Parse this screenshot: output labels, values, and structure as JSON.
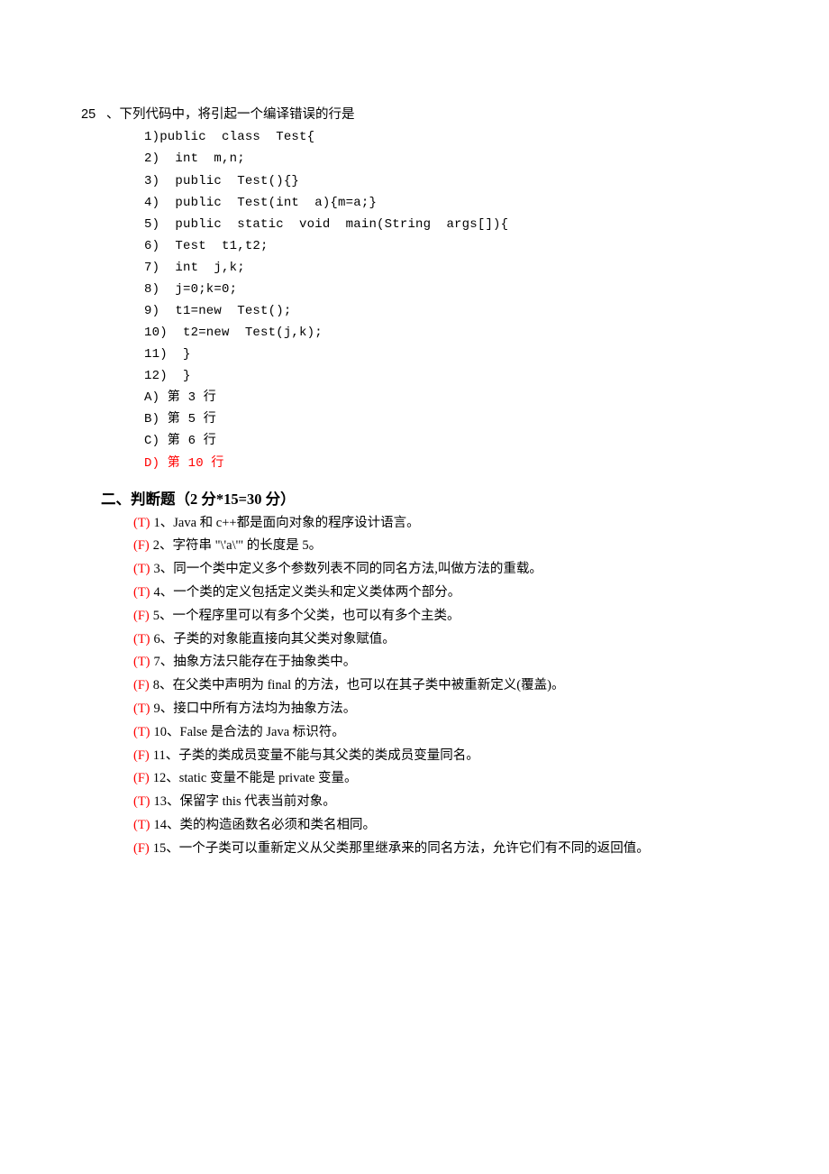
{
  "question25": {
    "number": "25",
    "stem_sep": "、",
    "stem_text": "下列代码中，将引起一个编译错误的行是",
    "code": [
      "1)public  class  Test{",
      "2)  int  m,n;",
      "3)  public  Test(){}",
      "4)  public  Test(int  a){m=a;}",
      "5)  public  static  void  main(String  args[]){",
      "6)  Test  t1,t2;",
      "7)  int  j,k;",
      "8)  j=0;k=0;",
      "9)  t1=new  Test();",
      "10)  t2=new  Test(j,k);",
      "11)  }",
      "12)  }"
    ],
    "options": {
      "A": "A) 第 3 行",
      "B": "B) 第 5 行",
      "C": "C) 第 6 行",
      "D": "D) 第 10 行"
    }
  },
  "section2": {
    "header": "二、判断题（2 分*15=30 分）",
    "items": [
      {
        "mark": "(T)",
        "text": "1、Java 和 c++都是面向对象的程序设计语言。"
      },
      {
        "mark": "(F)",
        "text": "2、字符串 \"\\'a\\'\" 的长度是 5。"
      },
      {
        "mark": "(T)",
        "text": "3、同一个类中定义多个参数列表不同的同名方法,叫做方法的重载。"
      },
      {
        "mark": "(T)",
        "text": "4、一个类的定义包括定义类头和定义类体两个部分。"
      },
      {
        "mark": "(F)",
        "text": "5、一个程序里可以有多个父类，也可以有多个主类。"
      },
      {
        "mark": "(T)",
        "text": "6、子类的对象能直接向其父类对象赋值。"
      },
      {
        "mark": "(T)",
        "text": "7、抽象方法只能存在于抽象类中。"
      },
      {
        "mark": "(F)",
        "text": "8、在父类中声明为 final 的方法，也可以在其子类中被重新定义(覆盖)。"
      },
      {
        "mark": "(T)",
        "text": "9、接口中所有方法均为抽象方法。"
      },
      {
        "mark": "(T)",
        "text": "10、False 是合法的 Java 标识符。"
      },
      {
        "mark": "(F)",
        "text": "11、子类的类成员变量不能与其父类的类成员变量同名。"
      },
      {
        "mark": "(F)",
        "text": "12、static 变量不能是 private 变量。"
      },
      {
        "mark": "(T)",
        "text": "13、保留字 this 代表当前对象。"
      },
      {
        "mark": "(T)",
        "text": "14、类的构造函数名必须和类名相同。"
      },
      {
        "mark": "(F)",
        "text": "15、一个子类可以重新定义从父类那里继承来的同名方法，允许它们有不同的返回值。"
      }
    ]
  }
}
